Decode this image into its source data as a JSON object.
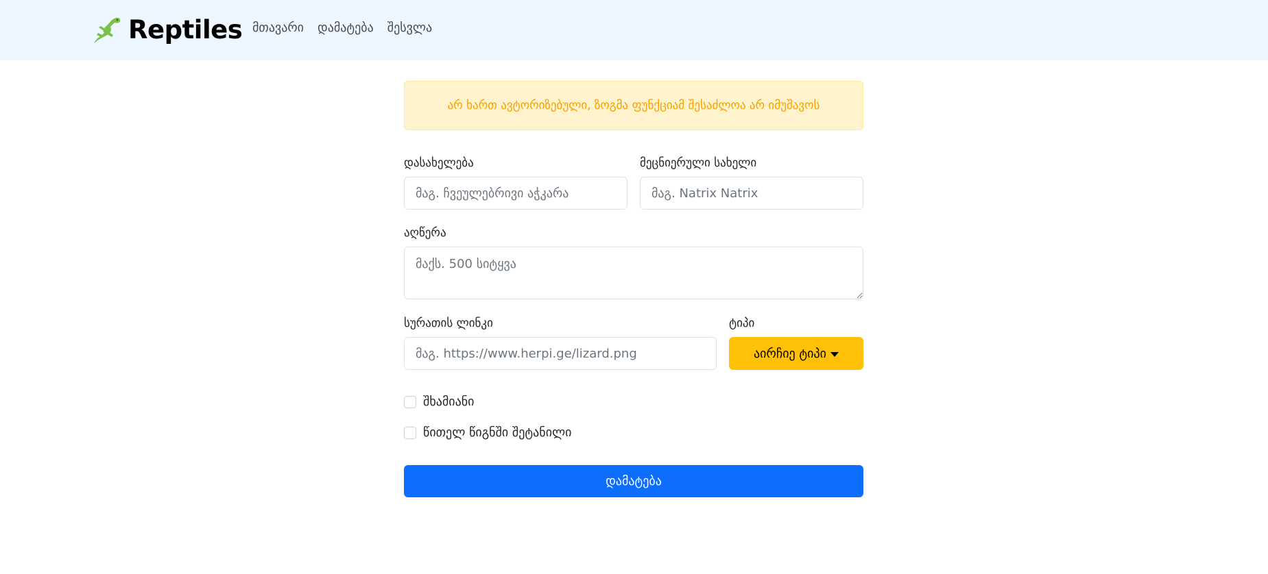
{
  "navbar": {
    "brand_text": "Reptiles",
    "brand_icon": "lizard-icon",
    "links": [
      "მთავარი",
      "დამატება",
      "შესვლა"
    ]
  },
  "alert": {
    "text": "არ ხართ ავტორიზებული, ზოგმა ფუნქციამ შესაძლოა არ იმუშავოს",
    "color": "#f5a100"
  },
  "form": {
    "name_label": "დასახელება",
    "name_placeholder": "მაგ. ჩვეულებრივი აჭკარა",
    "scientific_label": "მეცნიერული სახელი",
    "scientific_placeholder": "მაგ. Natrix Natrix",
    "description_label": "აღწერა",
    "description_placeholder": "მაქს. 500 სიტყვა",
    "image_label": "სურათის ლინკი",
    "image_placeholder": "მაგ. https://www.herpi.ge/lizard.png",
    "type_label": "ტიპი",
    "type_button": "აირჩიე ტიპი",
    "venomous_label": "შხამიანი",
    "redbook_label": "წითელ წიგნში შეტანილი",
    "submit_label": "დამატება"
  },
  "colors": {
    "navbar_bg": "#eef6ff",
    "primary": "#0d6efd",
    "warning": "#ffc107",
    "alert_bg": "#fff3cd"
  }
}
